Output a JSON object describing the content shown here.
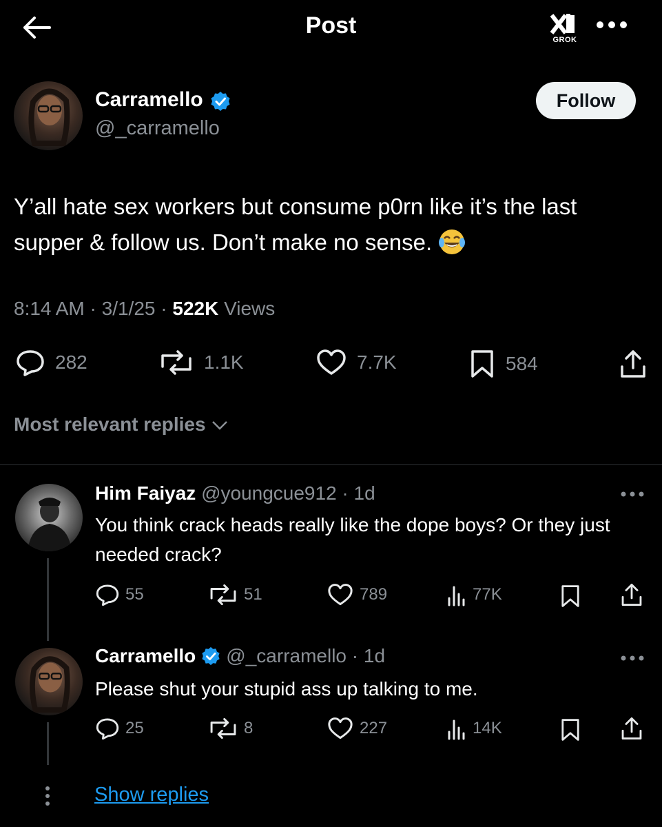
{
  "header": {
    "title": "Post",
    "grok_label": "GROK"
  },
  "post": {
    "author_name": "Carramello",
    "author_handle": "@_carramello",
    "follow_label": "Follow",
    "text": "Y’all hate sex workers but consume p0rn like it’s the last supper & follow us. Don’t make no sense.",
    "time": "8:14 AM",
    "date": "3/1/25",
    "views_count": "522K",
    "views_label": "Views",
    "replies": "282",
    "reposts": "1.1K",
    "likes": "7.7K",
    "bookmarks": "584"
  },
  "sort_label": "Most relevant replies",
  "replies": [
    {
      "name": "Him Faiyaz",
      "handle": "@youngcue912",
      "age": "1d",
      "text": "You think crack heads really like the dope boys? Or they just needed crack?",
      "replies": "55",
      "reposts": "51",
      "likes": "789",
      "views": "77K"
    },
    {
      "name": "Carramello",
      "handle": "@_carramello",
      "age": "1d",
      "text": "Please shut your stupid ass up talking to me.",
      "replies": "25",
      "reposts": "8",
      "likes": "227",
      "views": "14K"
    }
  ],
  "show_replies_label": "Show replies",
  "colors": {
    "background": "#000000",
    "accent": "#1d9bf0",
    "muted": "#8b9096",
    "verified": "#1d9bf0"
  },
  "icons": [
    "back-arrow-icon",
    "grok-icon",
    "more-icon",
    "verified-badge-icon",
    "reply-icon",
    "repost-icon",
    "like-icon",
    "bookmark-icon",
    "share-icon",
    "views-icon",
    "chevron-down-icon",
    "laughing-emoji-icon"
  ]
}
